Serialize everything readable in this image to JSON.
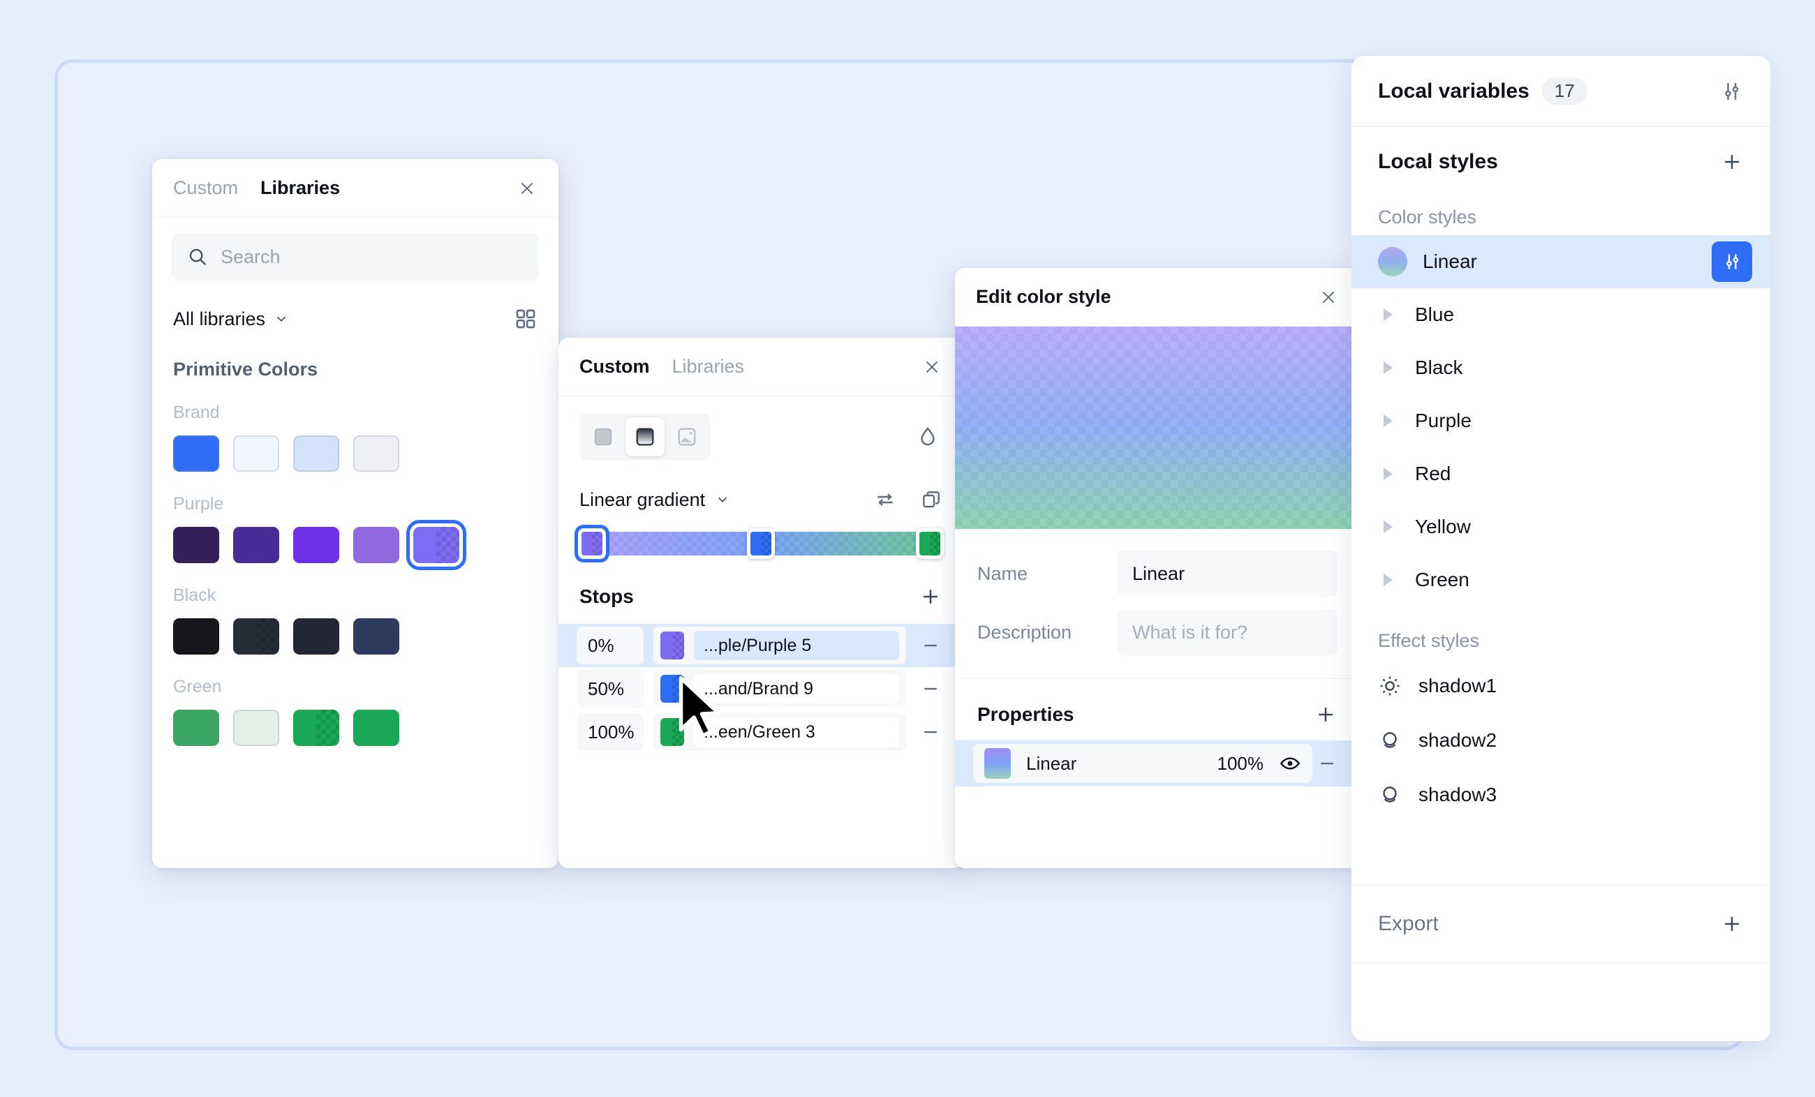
{
  "theme": {
    "accent": "#2f6df6",
    "canvas_bg": "#e6f0fd",
    "frame_bg": "#e9effc",
    "frame_border": "#cadcf7",
    "selection_row": "#dbe9fd"
  },
  "libraries_panel": {
    "tabs": [
      {
        "label": "Custom",
        "active": false
      },
      {
        "label": "Libraries",
        "active": true
      }
    ],
    "close_label": "close-icon",
    "search": {
      "placeholder": "Search",
      "value": ""
    },
    "library_filter": "All libraries",
    "section_title": "Primitive Colors",
    "groups": [
      {
        "label": "Brand",
        "swatches": [
          {
            "color": "#2f6df6",
            "checker": false,
            "selected": false
          },
          {
            "color": "#f1f5fe",
            "checker": false,
            "selected": false
          },
          {
            "color": "#d4e2fb",
            "checker": false,
            "selected": false
          },
          {
            "color": "#eef0f4",
            "checker": false,
            "selected": false
          }
        ]
      },
      {
        "label": "Purple",
        "swatches": [
          {
            "color": "#352059",
            "checker": false,
            "selected": false
          },
          {
            "color": "#4a2c96",
            "checker": false,
            "selected": false
          },
          {
            "color": "#6f31e8",
            "checker": false,
            "selected": false
          },
          {
            "color": "#9068e0",
            "checker": false,
            "selected": false
          },
          {
            "color": "#7f6cf5",
            "checker": true,
            "selected": true
          }
        ]
      },
      {
        "label": "Black",
        "swatches": [
          {
            "color": "#16161a",
            "checker": false,
            "selected": false
          },
          {
            "color": "#262b38",
            "checker": true,
            "selected": false
          },
          {
            "color": "#232735",
            "checker": false,
            "selected": false
          },
          {
            "color": "#2e3b5e",
            "checker": false,
            "selected": false
          }
        ]
      },
      {
        "label": "Green",
        "swatches": [
          {
            "color": "#3ba565",
            "checker": false,
            "selected": false
          },
          {
            "color": "#e4f0e8",
            "checker": false,
            "selected": false
          },
          {
            "color": "#1aa756",
            "checker": true,
            "selected": false
          },
          {
            "color": "#1aa756",
            "checker": false,
            "selected": false
          }
        ]
      }
    ]
  },
  "custom_panel": {
    "tabs": [
      {
        "label": "Custom",
        "active": true
      },
      {
        "label": "Libraries",
        "active": false
      }
    ],
    "fill_types": [
      {
        "name": "solid-fill",
        "selected": false
      },
      {
        "name": "gradient-fill",
        "selected": true
      },
      {
        "name": "image-fill",
        "selected": false
      }
    ],
    "eyedropper": "droplet-icon",
    "gradient_type": "Linear gradient",
    "actions": {
      "reverse": "reverse-icon",
      "rotate": "rotate-copy-icon"
    },
    "gradient_bar": {
      "handles": [
        {
          "pos_pct": 0,
          "color": "#7f6cf5",
          "selected": true
        },
        {
          "pos_pct": 50,
          "color": "#2f6df6",
          "selected": false
        },
        {
          "pos_pct": 100,
          "color": "#1aa756",
          "selected": false
        }
      ]
    },
    "stops_title": "Stops",
    "stops_add_label": "plus-icon",
    "stops": [
      {
        "percent": "0%",
        "color": "#7f6cf5",
        "variable": "...ple/Purple 5",
        "selected": true
      },
      {
        "percent": "50%",
        "color": "#2f6df6",
        "variable": "...and/Brand 9",
        "selected": false
      },
      {
        "percent": "100%",
        "color": "#1aa756",
        "variable": "...een/Green 3",
        "selected": false
      }
    ]
  },
  "edit_panel": {
    "title": "Edit color style",
    "close_label": "close-icon",
    "fields": {
      "name_label": "Name",
      "name_value": "Linear",
      "description_label": "Description",
      "description_value": "",
      "description_placeholder": "What is it for?"
    },
    "properties_title": "Properties",
    "properties_add_label": "plus-icon",
    "properties": [
      {
        "name": "Linear",
        "opacity": "100%",
        "visible": true,
        "selected": true
      }
    ]
  },
  "right_panel": {
    "local_variables": {
      "label": "Local variables",
      "count": "17",
      "settings_icon": "sliders-icon"
    },
    "local_styles": {
      "label": "Local styles",
      "add_icon": "plus-icon"
    },
    "color_styles_label": "Color styles",
    "color_styles": [
      {
        "label": "Linear",
        "type": "swatch",
        "selected": true,
        "action_icon": "sliders-icon"
      },
      {
        "label": "Blue",
        "type": "folder",
        "selected": false
      },
      {
        "label": "Black",
        "type": "folder",
        "selected": false
      },
      {
        "label": "Purple",
        "type": "folder",
        "selected": false
      },
      {
        "label": "Red",
        "type": "folder",
        "selected": false
      },
      {
        "label": "Yellow",
        "type": "folder",
        "selected": false
      },
      {
        "label": "Green",
        "type": "folder",
        "selected": false
      }
    ],
    "effect_styles_label": "Effect styles",
    "effect_styles": [
      {
        "label": "shadow1",
        "icon": "sun-icon"
      },
      {
        "label": "shadow2",
        "icon": "drop-shadow-icon"
      },
      {
        "label": "shadow3",
        "icon": "drop-shadow-icon"
      }
    ],
    "export": {
      "label": "Export",
      "add_icon": "plus-icon"
    }
  }
}
